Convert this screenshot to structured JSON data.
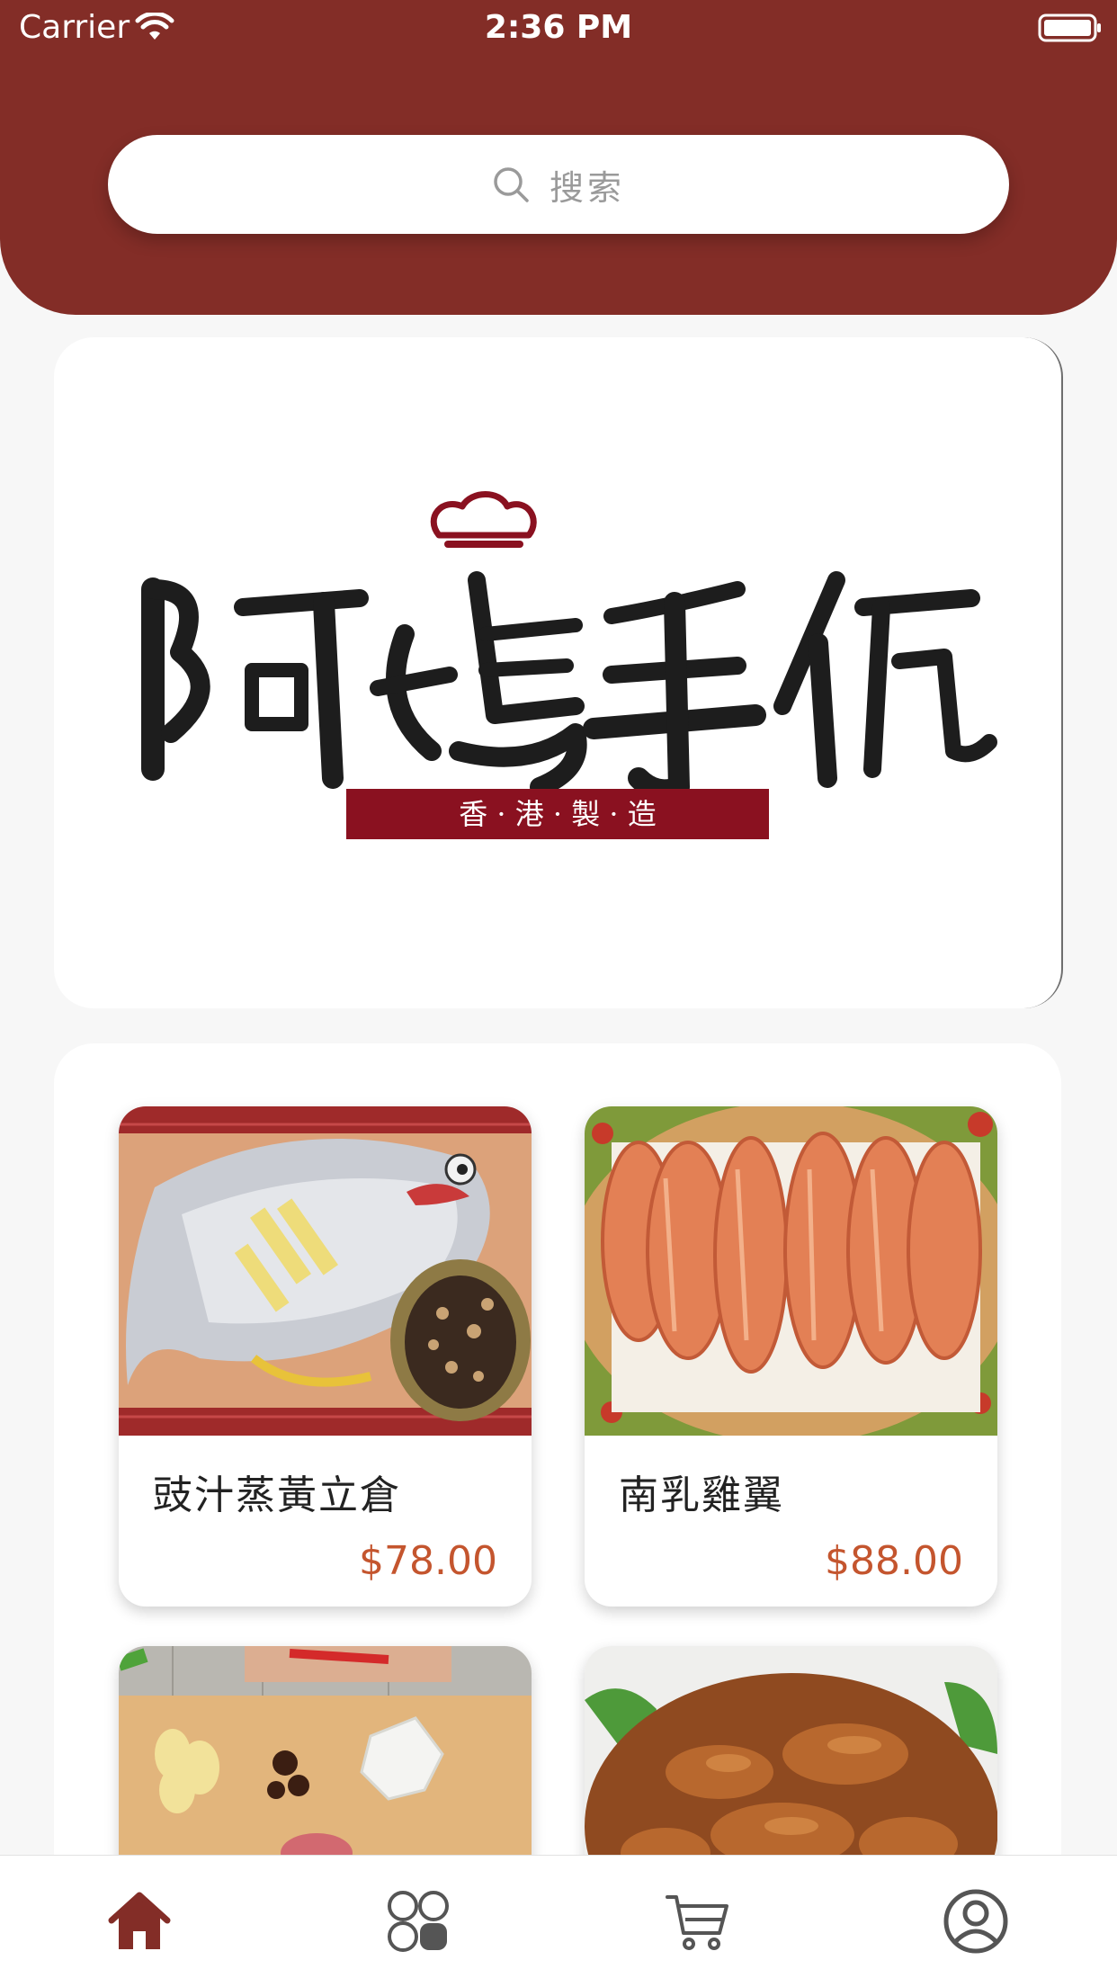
{
  "status_bar": {
    "carrier": "Carrier",
    "time": "2:36 PM",
    "wifi_icon": "wifi-icon",
    "battery_icon": "battery-icon"
  },
  "search": {
    "placeholder": "搜索",
    "icon": "search-icon"
  },
  "banner": {
    "brand_name": "阿媽手作",
    "tagline": "香 · 港 · 製 · 造"
  },
  "products": [
    {
      "name": "豉汁蒸黃立倉",
      "price": "$78.00"
    },
    {
      "name": "南乳雞翼",
      "price": "$88.00"
    },
    {
      "name": "",
      "price": ""
    },
    {
      "name": "",
      "price": ""
    }
  ],
  "tab_bar": {
    "items": [
      {
        "icon": "home-icon",
        "active": true
      },
      {
        "icon": "categories-icon",
        "active": false
      },
      {
        "icon": "cart-icon",
        "active": false
      },
      {
        "icon": "profile-icon",
        "active": false
      }
    ]
  },
  "colors": {
    "brand": "#832d27",
    "price": "#c4552e",
    "logo_red": "#8a1120",
    "tab_active": "#832d27",
    "tab_inactive": "#555555"
  }
}
